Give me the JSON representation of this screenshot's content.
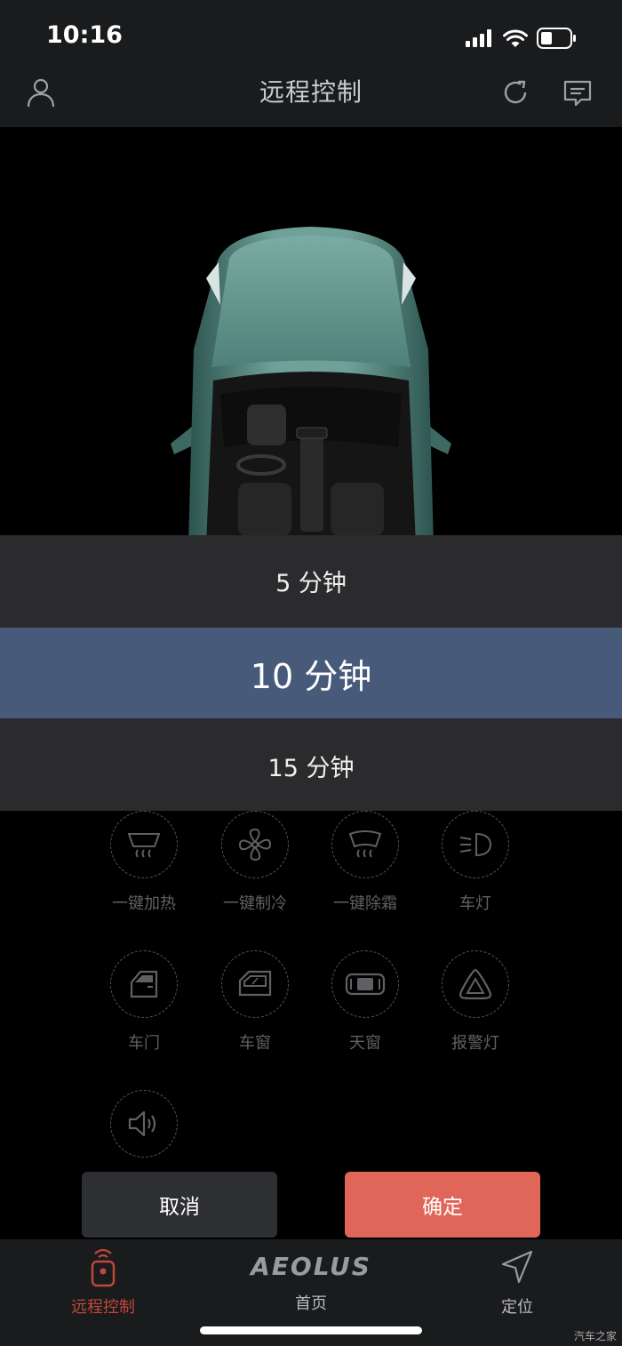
{
  "status_bar": {
    "time": "10:16"
  },
  "header": {
    "title": "远程控制"
  },
  "picker": {
    "options": [
      "5 分钟",
      "10 分钟",
      "15 分钟"
    ],
    "selected": "10 分钟"
  },
  "controls": {
    "row1": [
      "一键加热",
      "一键制冷",
      "一键除霜",
      "车灯"
    ],
    "row2": [
      "车门",
      "车窗",
      "天窗",
      "报警灯"
    ]
  },
  "buttons": {
    "cancel": "取消",
    "confirm": "确定"
  },
  "tabbar": {
    "items": [
      {
        "label": "远程控制",
        "icon": "remote-key-icon",
        "active": true
      },
      {
        "label": "首页",
        "icon": "aeolus-logo",
        "logo_text": "AEOLUS"
      },
      {
        "label": "定位",
        "icon": "location-arrow-icon"
      }
    ]
  },
  "watermark": "汽车之家",
  "colors": {
    "accent": "#e0665a",
    "active_tab": "#c1473b",
    "picker_selected": "#485a7a",
    "car_body": "#6b9a92"
  }
}
